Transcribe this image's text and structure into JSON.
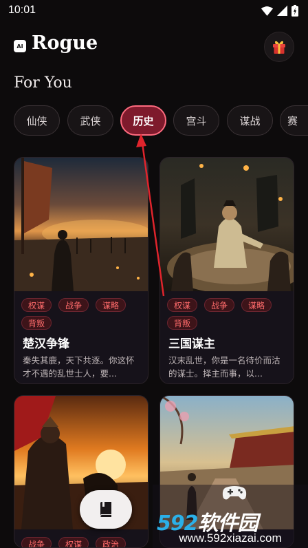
{
  "status_bar": {
    "time": "10:01"
  },
  "header": {
    "logo_text": "AI",
    "title": "Rogue"
  },
  "section": {
    "title": "For You"
  },
  "tabs": [
    {
      "label": "仙侠",
      "active": false
    },
    {
      "label": "武侠",
      "active": false
    },
    {
      "label": "历史",
      "active": true
    },
    {
      "label": "宫斗",
      "active": false
    },
    {
      "label": "谋战",
      "active": false
    },
    {
      "label": "赛",
      "active": false
    }
  ],
  "cards": [
    {
      "tags": [
        "权谋",
        "战争",
        "谋略",
        "背叛"
      ],
      "title": "楚汉争锋",
      "desc": "秦失其鹿，天下共逐。你这怀才不遇的乱世士人，要..."
    },
    {
      "tags": [
        "权谋",
        "战争",
        "谋略",
        "背叛"
      ],
      "title": "三国谋主",
      "desc": "汉末乱世，你是一名待价而沽的谋士。择主而事，以..."
    },
    {
      "tags": [
        "战争",
        "权谋",
        "政治"
      ],
      "title": "",
      "desc": ""
    },
    {
      "tags": [],
      "title": "",
      "desc": ""
    }
  ],
  "watermark": {
    "brand_a": "592",
    "brand_b": "软件园",
    "url": "www.592xiazai.com"
  },
  "colors": {
    "accent": "#7e1a2c",
    "accent_border": "#ff6b7f",
    "tag_text": "#ff6b6b",
    "background": "#0d0b0c"
  },
  "icons": {
    "gift": "gift-icon",
    "book": "book-icon",
    "gamepad": "gamepad-icon"
  }
}
